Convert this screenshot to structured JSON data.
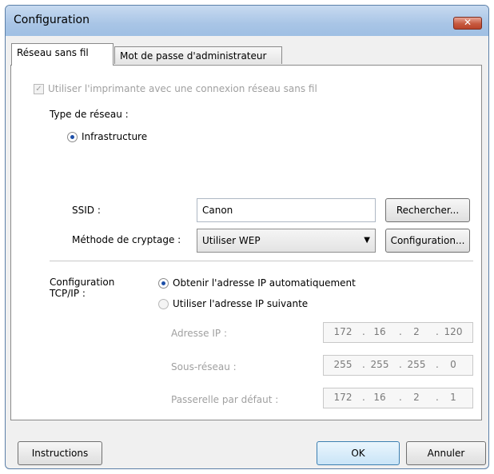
{
  "window": {
    "title": "Configuration",
    "close_glyph": "✕"
  },
  "tabs": [
    {
      "label": "Réseau sans fil",
      "active": true
    },
    {
      "label": "Mot de passe d'administrateur",
      "active": false
    }
  ],
  "wireless": {
    "use_wireless_label": "Utiliser l'imprimante avec une connexion réseau sans fil",
    "use_wireless_checked": true,
    "network_type_label": "Type de réseau :",
    "infrastructure_label": "Infrastructure",
    "ssid_label": "SSID :",
    "ssid_value": "Canon",
    "search_button": "Rechercher...",
    "encryption_label": "Méthode de cryptage :",
    "encryption_value": "Utiliser WEP",
    "config_button": "Configuration..."
  },
  "tcpip": {
    "label_line1": "Configuration",
    "label_line2": "TCP/IP :",
    "auto_label": "Obtenir l'adresse IP automatiquement",
    "auto_selected": true,
    "manual_label": "Utiliser l'adresse IP suivante",
    "ip_label": "Adresse IP :",
    "ip": [
      "172",
      "16",
      "2",
      "120"
    ],
    "subnet_label": "Sous-réseau :",
    "subnet": [
      "255",
      "255",
      "255",
      "0"
    ],
    "gateway_label": "Passerelle par défaut :",
    "gateway": [
      "172",
      "16",
      "2",
      "1"
    ]
  },
  "footer": {
    "instructions_button": "Instructions",
    "ok_button": "OK",
    "cancel_button": "Annuler"
  },
  "icons": {
    "checkbox": "check-icon",
    "dropdown": "chevron-down-icon"
  },
  "colors": {
    "titlebar": "#a9c5e6",
    "close_button": "#c75a3f",
    "radio_selected": "#1d4fa8"
  }
}
